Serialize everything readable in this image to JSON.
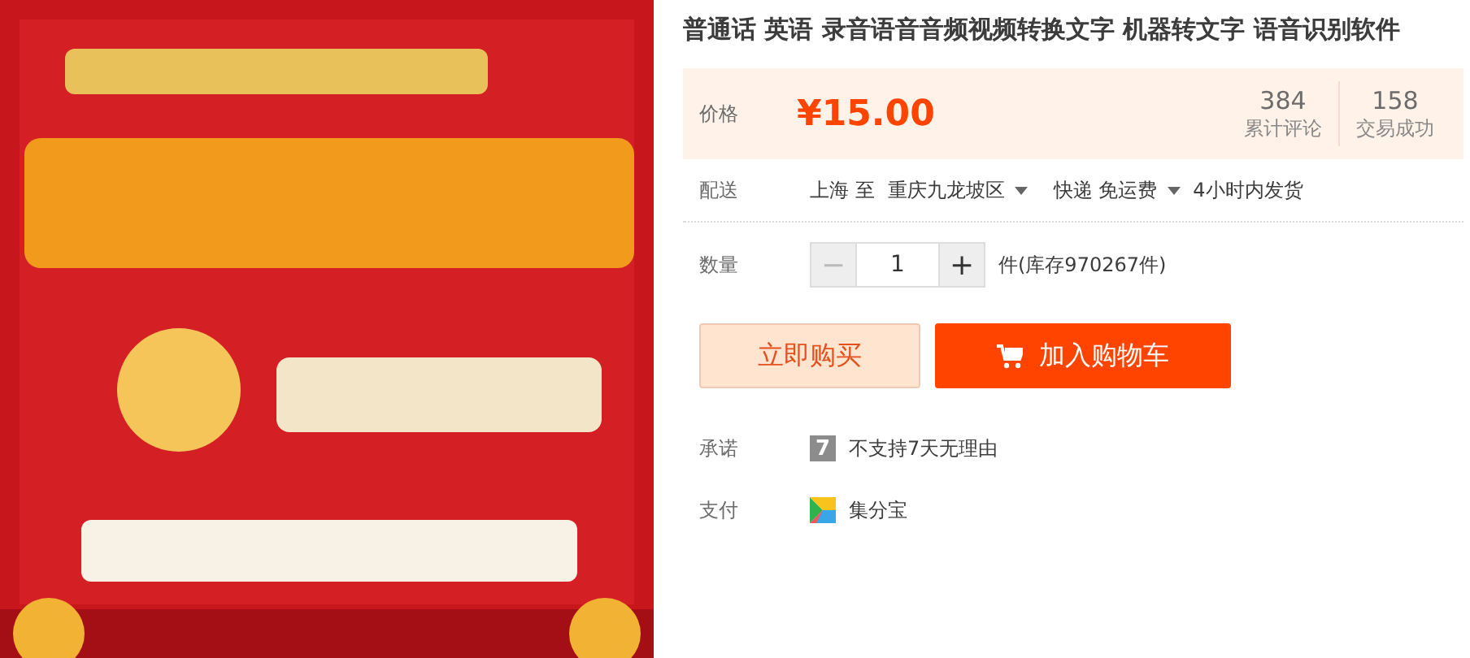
{
  "title": "普通话 英语 录音语音音频视频转换文字 机器转文字 语音识别软件",
  "price": {
    "label": "价格",
    "currency": "¥",
    "amount": "15.00"
  },
  "stats": [
    {
      "value": "384",
      "label": "累计评论"
    },
    {
      "value": "158",
      "label": "交易成功"
    }
  ],
  "delivery": {
    "label": "配送",
    "from": "上海",
    "to_word": "至",
    "destination": "重庆九龙坡区",
    "shipping": "快递 免运费",
    "dispatch": "4小时内发货"
  },
  "quantity": {
    "label": "数量",
    "minus": "−",
    "value": "1",
    "plus": "+",
    "stock": "件(库存970267件)"
  },
  "buttons": [
    {
      "kind": "buy",
      "label": "立即购买"
    },
    {
      "kind": "cart",
      "label": "加入购物车"
    }
  ],
  "promise": {
    "label": "承诺",
    "badge": "7",
    "text": "不支持7天无理由"
  },
  "payment": {
    "label": "支付",
    "text": "集分宝"
  }
}
